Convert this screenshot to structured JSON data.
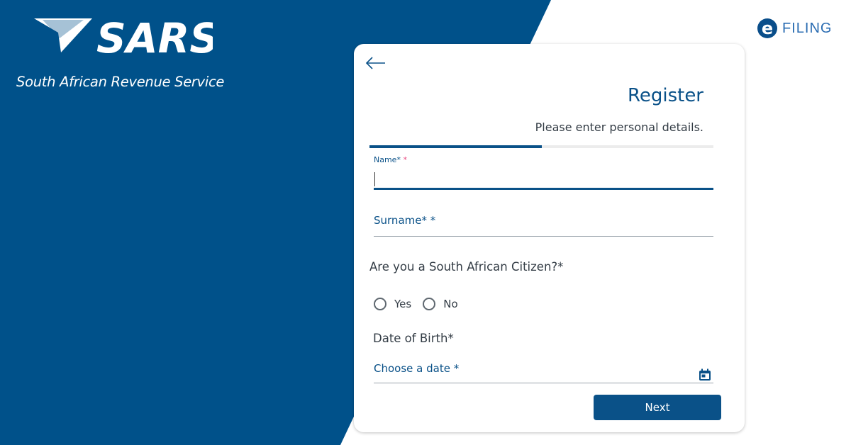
{
  "brand": {
    "logo_text": "SARS",
    "subtitle": "South African Revenue Service",
    "efiling_letter": "e",
    "efiling_text": "FILING",
    "primary_color": "#0a5188",
    "background_blue": "#00518a"
  },
  "form": {
    "back_icon": "arrow-left-icon",
    "title": "Register",
    "subtitle": "Please enter personal details.",
    "progress": 0.5,
    "name_label": "Name*",
    "name_required": "*",
    "name_value": "",
    "surname_label": "Surname* *",
    "citizen_question": "Are you a South African Citizen?*",
    "radio_options": [
      "Yes",
      "No"
    ],
    "dob_label": "Date of Birth*",
    "date_placeholder": "Choose a date *",
    "calendar_icon": "calendar-icon",
    "next_label": "Next"
  }
}
